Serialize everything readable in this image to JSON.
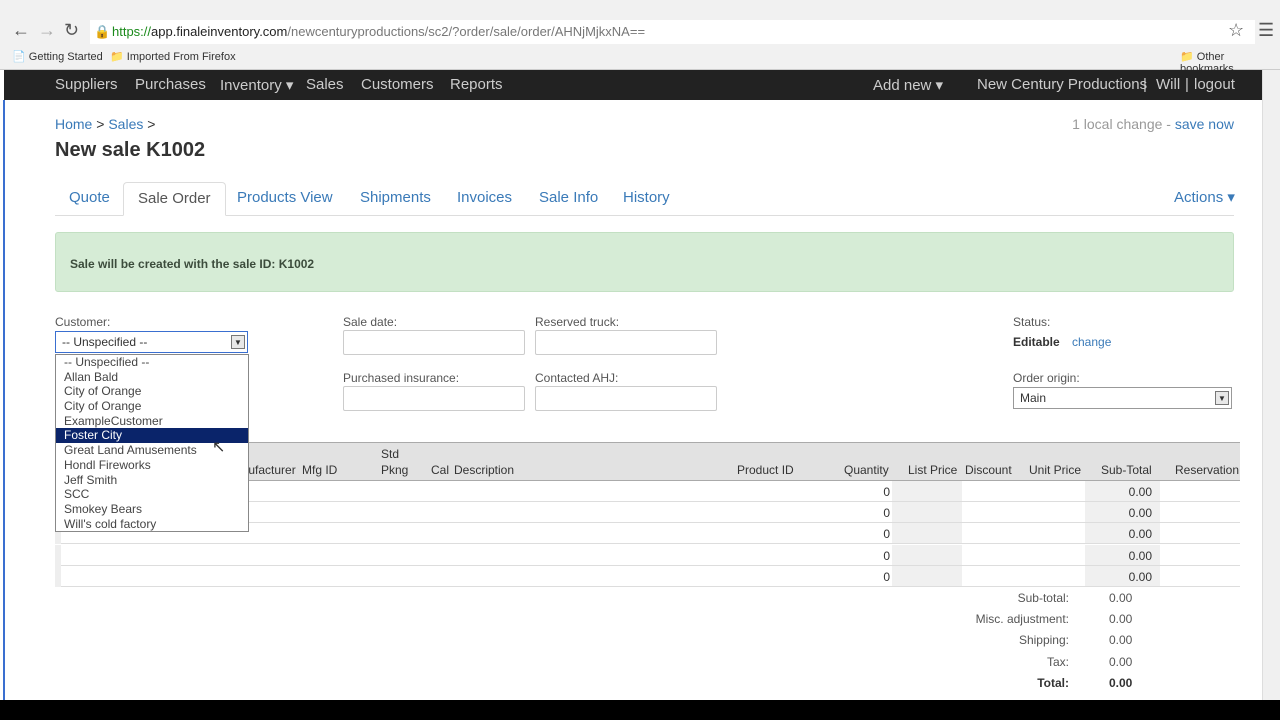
{
  "browser": {
    "url_scheme": "https://",
    "url_domain": "app.finaleinventory.com",
    "url_path": "/newcenturyproductions/sc2/?order/sale/order/AHNjMjkxNA==",
    "bookmarks": [
      "Getting Started",
      "Imported From Firefox"
    ],
    "other_bookmarks": "Other bookmarks"
  },
  "nav": {
    "left": [
      "Suppliers",
      "Purchases",
      "Inventory ▾",
      "Sales",
      "Customers",
      "Reports"
    ],
    "add_new": "Add new ▾",
    "company": "New Century Productions",
    "sep": "|",
    "user": "Will",
    "logout": "logout"
  },
  "breadcrumb": {
    "home": "Home",
    "sep": ">",
    "sales": "Sales"
  },
  "local_change": "1 local change -",
  "save_now": "save now",
  "title": "New sale K1002",
  "tabs": [
    "Quote",
    "Sale Order",
    "Products View",
    "Shipments",
    "Invoices",
    "Sale Info",
    "History"
  ],
  "actions": "Actions ▾",
  "alert": "Sale will be created with the sale ID: K1002",
  "form": {
    "customer_label": "Customer:",
    "customer_value": "-- Unspecified --",
    "sale_date_label": "Sale date:",
    "reserved_truck_label": "Reserved truck:",
    "purchased_insurance_label": "Purchased insurance:",
    "contacted_ahj_label": "Contacted AHJ:",
    "status_label": "Status:",
    "status_value": "Editable",
    "status_change": "change",
    "order_origin_label": "Order origin:",
    "order_origin_value": "Main"
  },
  "customer_options": [
    "-- Unspecified --",
    "Allan Bald",
    "City of Orange",
    "City of Orange",
    "ExampleCustomer",
    "Foster City",
    "Great Land Amusements",
    "Hondl Fireworks",
    "Jeff Smith",
    "SCC",
    "Smokey Bears",
    "Will's cold factory"
  ],
  "highlighted_option": "Foster City",
  "table": {
    "headers": {
      "manufacturer": "Manufacturer",
      "mfg_id": "Mfg ID",
      "std": "Std",
      "pkng": "Pkng",
      "cal": "Cal",
      "description": "Description",
      "product_id": "Product ID",
      "quantity": "Quantity",
      "list_price": "List Price",
      "discount": "Discount",
      "unit_price": "Unit Price",
      "sub_total": "Sub-Total",
      "reservation": "Reservation"
    },
    "rows": [
      {
        "quantity": "0",
        "sub_total": "0.00"
      },
      {
        "quantity": "0",
        "sub_total": "0.00"
      },
      {
        "quantity": "0",
        "sub_total": "0.00"
      },
      {
        "quantity": "0",
        "sub_total": "0.00"
      },
      {
        "quantity": "0",
        "sub_total": "0.00"
      }
    ]
  },
  "totals": [
    {
      "label": "Sub-total:",
      "value": "0.00"
    },
    {
      "label": "Misc. adjustment:",
      "value": "0.00"
    },
    {
      "label": "Shipping:",
      "value": "0.00"
    },
    {
      "label": "Tax:",
      "value": "0.00"
    },
    {
      "label": "Total:",
      "value": "0.00"
    }
  ]
}
